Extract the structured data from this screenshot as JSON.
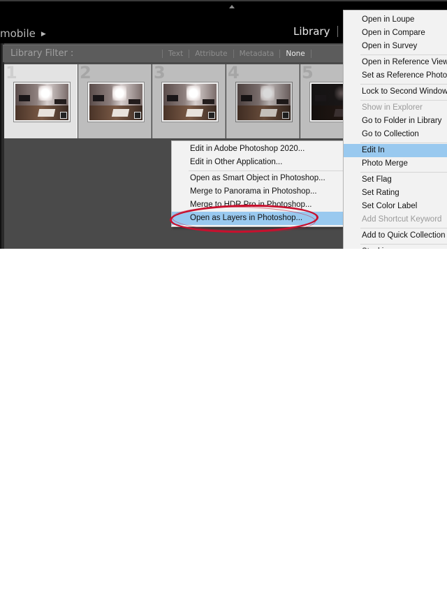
{
  "header": {
    "identity_text": "mobile",
    "identity_arrow": "▶",
    "active_module": "Library"
  },
  "filter_bar": {
    "label": "Library Filter :",
    "options": [
      "Text",
      "Attribute",
      "Metadata",
      "None"
    ],
    "active_option": "None"
  },
  "grid": {
    "cells": [
      {
        "index": "1",
        "selected": true
      },
      {
        "index": "2",
        "selected": false
      },
      {
        "index": "3",
        "selected": false
      },
      {
        "index": "4",
        "selected": false
      },
      {
        "index": "5",
        "selected": false
      }
    ]
  },
  "context_menu": {
    "items": [
      {
        "label": "Open in Loupe",
        "enabled": true
      },
      {
        "label": "Open in Compare",
        "enabled": true
      },
      {
        "label": "Open in Survey",
        "enabled": true
      },
      {
        "label": "Open in Reference View",
        "enabled": true
      },
      {
        "label": "Set as Reference Photo",
        "enabled": true
      },
      {
        "label": "Lock to Second Window",
        "enabled": true
      },
      {
        "label": "Show in Explorer",
        "enabled": false
      },
      {
        "label": "Go to Folder in Library",
        "enabled": true
      },
      {
        "label": "Go to Collection",
        "enabled": true
      },
      {
        "label": "Edit In",
        "enabled": true,
        "highlighted": true
      },
      {
        "label": "Photo Merge",
        "enabled": true
      },
      {
        "label": "Set Flag",
        "enabled": true
      },
      {
        "label": "Set Rating",
        "enabled": true
      },
      {
        "label": "Set Color Label",
        "enabled": true
      },
      {
        "label": "Add Shortcut Keyword",
        "enabled": false
      },
      {
        "label": "Add to Quick Collection",
        "enabled": true
      },
      {
        "label": "Stacking",
        "enabled": true
      }
    ]
  },
  "edit_in_submenu": {
    "items": [
      {
        "label": "Edit in Adobe Photoshop 2020..."
      },
      {
        "label": "Edit in Other Application..."
      },
      {
        "label": "Open as Smart Object in Photoshop..."
      },
      {
        "label": "Merge to Panorama in Photoshop..."
      },
      {
        "label": "Merge to HDR Pro in Photoshop..."
      },
      {
        "label": "Open as Layers in Photoshop...",
        "highlighted": true
      }
    ]
  },
  "annotation": {
    "type": "red-ellipse",
    "target": "Open as Layers in Photoshop...",
    "color": "#c8102e"
  },
  "colors": {
    "menu_highlight": "#99c9ef",
    "menu_background": "#f2f2f2",
    "panel_background": "#4a4a4a",
    "topbar_background": "#000000"
  }
}
